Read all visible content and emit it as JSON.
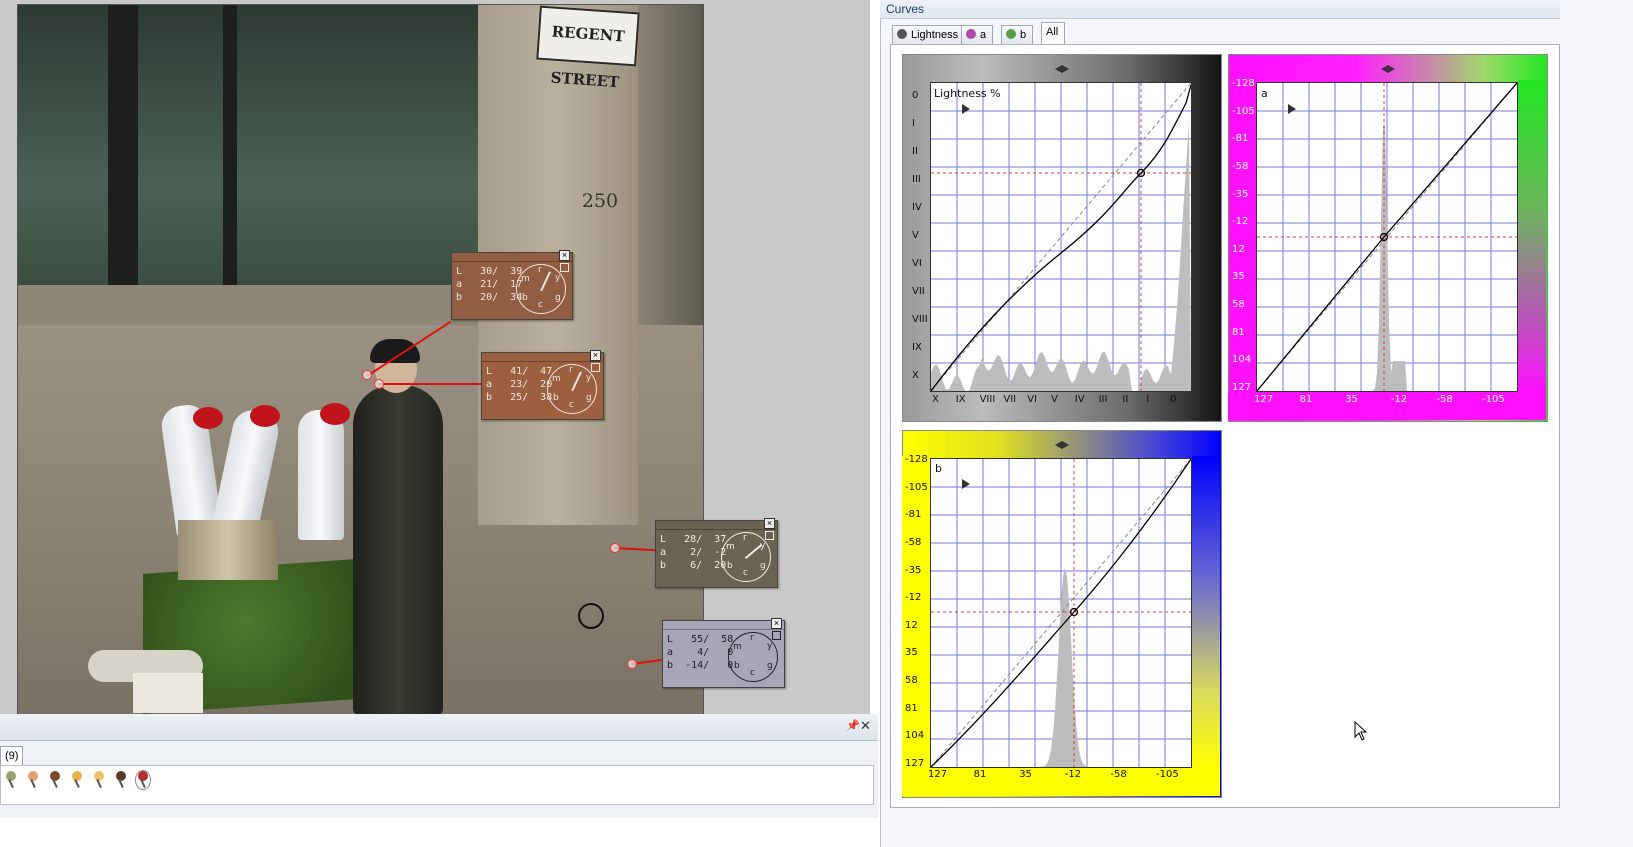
{
  "photo": {
    "sign_text": "REGENT STREET",
    "building_number": "250"
  },
  "pickers": [
    {
      "L": "L   30/  39",
      "a": "a   21/  17",
      "b": "b   20/  34",
      "bg": "#925e43",
      "fg": "#f2e6dc"
    },
    {
      "L": "L   41/  47",
      "a": "a   23/  20",
      "b": "b   25/  38",
      "bg": "#9c5f40",
      "fg": "#f2e6dc"
    },
    {
      "L": "L   28/  37",
      "a": "a    2/  -2",
      "b": "b    6/  20",
      "bg": "#6a6352",
      "fg": "#f0ede4"
    },
    {
      "L": "L   55/  58",
      "a": "a    4/   0",
      "b": "b  -14/   0",
      "bg": "#a9a5b8",
      "fg": "#222222"
    }
  ],
  "dial_letters": {
    "r": "r",
    "y": "y",
    "g": "g",
    "c": "c",
    "b": "b",
    "m": "m"
  },
  "bottom_panel": {
    "tab_label": "(9)",
    "pin_icon": "pushpin-icon",
    "close_icon": "close-icon",
    "pin_colors": [
      "#9aa06a",
      "#e0a070",
      "#7a4a2a",
      "#e9b04a",
      "#f0c070",
      "#5a3a2a",
      "#b52a2a"
    ]
  },
  "curves": {
    "title": "Curves",
    "tabs": [
      {
        "label": "Lightness",
        "icon_color": "#555"
      },
      {
        "label": "a",
        "icon_color": "#b04aa8"
      },
      {
        "label": "b",
        "icon_color": "#5aa04a"
      },
      {
        "label": "All",
        "icon_color": ""
      }
    ],
    "active_tab": "All",
    "lightness": {
      "label": "Lightness  %",
      "y_ticks": [
        "0",
        "I",
        "II",
        "III",
        "IV",
        "V",
        "VI",
        "VII",
        "VIII",
        "IX",
        "X"
      ],
      "x_ticks": [
        "X",
        "IX",
        "VIII",
        "VII",
        "VI",
        "V",
        "IV",
        "III",
        "II",
        "I",
        "0"
      ]
    },
    "a_panel": {
      "label": "a",
      "y_ticks": [
        "-128",
        "-105",
        "-81",
        "-58",
        "-35",
        "-12",
        "12",
        "35",
        "58",
        "81",
        "104",
        "127"
      ],
      "x_ticks": [
        "127",
        "81",
        "35",
        "-12",
        "-58",
        "-105"
      ]
    },
    "b_panel": {
      "label": "b",
      "y_ticks": [
        "-128",
        "-105",
        "-81",
        "-58",
        "-35",
        "-12",
        "12",
        "35",
        "58",
        "81",
        "104",
        "127"
      ],
      "x_ticks": [
        "127",
        "81",
        "35",
        "-12",
        "-58",
        "-105"
      ]
    }
  }
}
